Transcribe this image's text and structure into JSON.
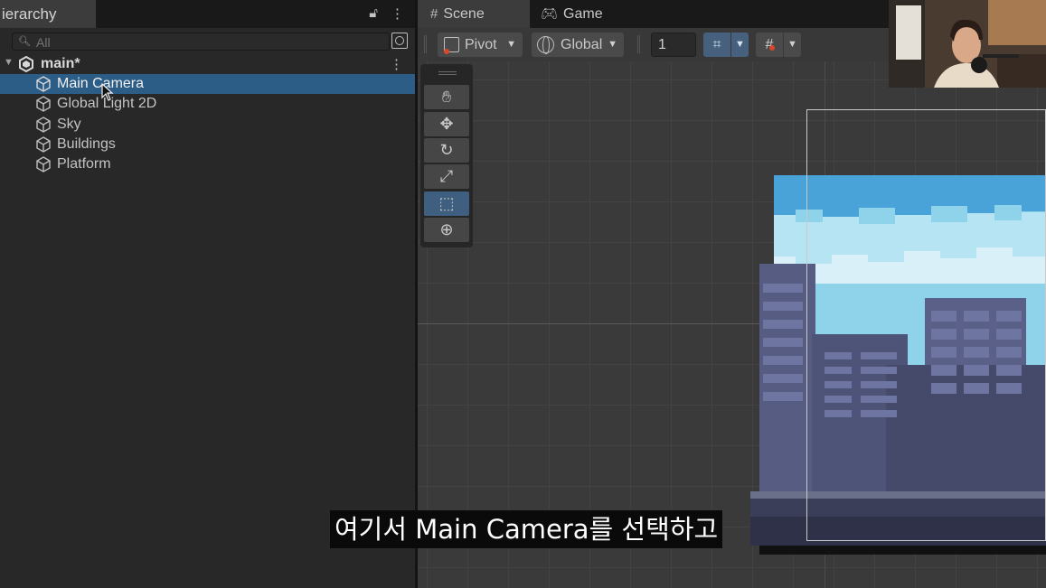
{
  "hierarchy": {
    "tab_label": "ierarchy",
    "search_placeholder": "All",
    "scene_name": "main*",
    "items": [
      {
        "label": "Main Camera"
      },
      {
        "label": "Global Light 2D"
      },
      {
        "label": "Sky"
      },
      {
        "label": "Buildings"
      },
      {
        "label": "Platform"
      }
    ]
  },
  "scene_view": {
    "tabs": [
      {
        "label": "Scene"
      },
      {
        "label": "Game"
      }
    ],
    "toolbar": {
      "pivot_label": "Pivot",
      "global_label": "Global",
      "grid_size": "1"
    }
  },
  "subtitle": "여기서 Main Camera를 선택하고",
  "colors": {
    "selection": "#2c5d87",
    "active_tool": "#3e5f80",
    "sky": "#8fd3ea",
    "buildings": "#4e5478"
  }
}
